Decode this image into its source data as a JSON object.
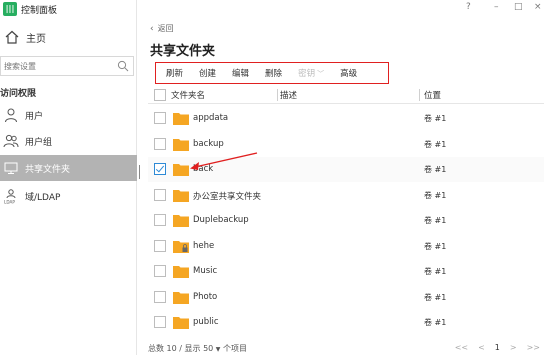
{
  "app": {
    "title": "控制面板",
    "logo_glyph": "|||"
  },
  "window_controls": {
    "help": "?",
    "minimize": "–",
    "maximize": "□",
    "close": "×"
  },
  "sidebar": {
    "home_label": "主页",
    "search_placeholder": "搜索设置",
    "section_title": "访问权限",
    "items": [
      {
        "label": "用户",
        "icon": "user-icon"
      },
      {
        "label": "用户组",
        "icon": "group-icon"
      },
      {
        "label": "共享文件夹",
        "icon": "shared-folder-icon",
        "active": true
      },
      {
        "label": "域/LDAP",
        "icon": "ldap-icon"
      }
    ]
  },
  "main": {
    "back_label": "返回",
    "title": "共享文件夹",
    "toolbar": [
      {
        "label": "刷新"
      },
      {
        "label": "创建"
      },
      {
        "label": "编辑"
      },
      {
        "label": "删除"
      },
      {
        "label": "密钥",
        "disabled": true,
        "has_caret": true
      },
      {
        "label": "高级"
      }
    ],
    "columns": {
      "name": "文件夹名",
      "description": "描述",
      "location": "位置"
    },
    "rows": [
      {
        "name": "appdata",
        "location": "卷 #1",
        "checked": false,
        "locked": false
      },
      {
        "name": "backup",
        "location": "卷 #1",
        "checked": false,
        "locked": false
      },
      {
        "name": "back",
        "location": "卷 #1",
        "checked": true,
        "locked": false
      },
      {
        "name": "办公室共享文件夹",
        "location": "卷 #1",
        "checked": false,
        "locked": false
      },
      {
        "name": "Duplebackup",
        "location": "卷 #1",
        "checked": false,
        "locked": false
      },
      {
        "name": "hehe",
        "location": "卷 #1",
        "checked": false,
        "locked": true
      },
      {
        "name": "Music",
        "location": "卷 #1",
        "checked": false,
        "locked": false
      },
      {
        "name": "Photo",
        "location": "卷 #1",
        "checked": false,
        "locked": false
      },
      {
        "name": "public",
        "location": "卷 #1",
        "checked": false,
        "locked": false
      }
    ],
    "footer": {
      "total_text": "总数 10 / 显示",
      "page_size": "50",
      "unit_text": "个项目"
    },
    "pager": {
      "first": "<<",
      "prev": "<",
      "page": "1",
      "next": ">",
      "last": ">>"
    }
  },
  "colors": {
    "accent_red": "#e02020",
    "folder": "#f5a623",
    "active_bg": "#b3b3b3",
    "check_blue": "#2d8ad6",
    "logo_green": "#27ae60"
  }
}
